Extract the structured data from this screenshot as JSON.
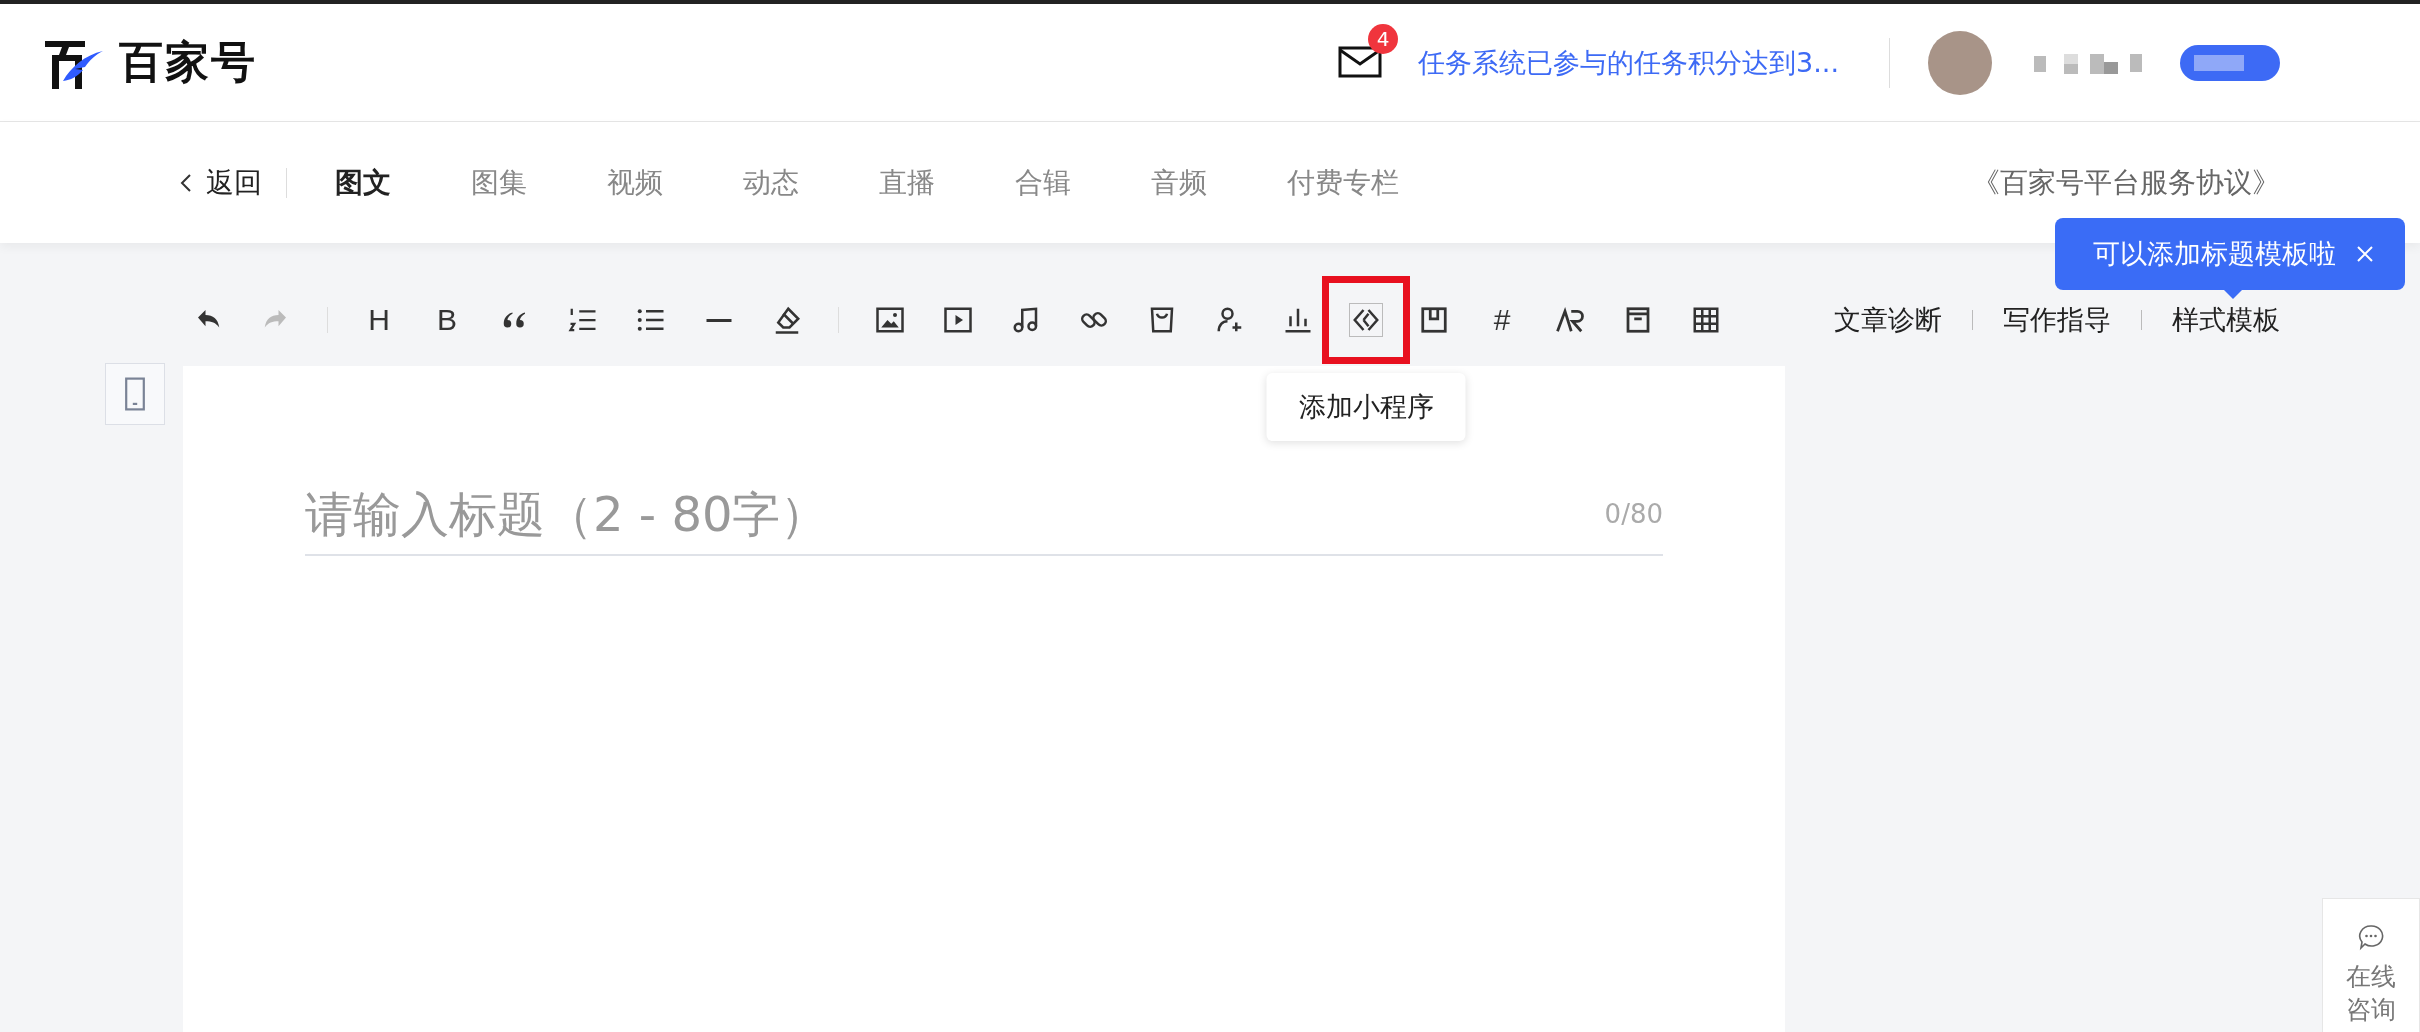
{
  "header": {
    "logo_text": "百家号",
    "notification": {
      "count": "4",
      "text": "任务系统已参与的任务积分达到3..."
    }
  },
  "nav": {
    "back": "返回",
    "tabs": [
      {
        "label": "图文",
        "selected": true
      },
      {
        "label": "图集",
        "selected": false
      },
      {
        "label": "视频",
        "selected": false
      },
      {
        "label": "动态",
        "selected": false
      },
      {
        "label": "直播",
        "selected": false
      },
      {
        "label": "合辑",
        "selected": false
      },
      {
        "label": "音频",
        "selected": false
      },
      {
        "label": "付费专栏",
        "selected": false
      }
    ],
    "agreement": "《百家号平台服务协议》"
  },
  "toolbar": {
    "items": [
      {
        "kind": "undo",
        "disabled": false,
        "hovered": false
      },
      {
        "kind": "redo",
        "disabled": true,
        "hovered": false
      },
      {
        "kind": "separator"
      },
      {
        "kind": "text",
        "label": "H",
        "disabled": false,
        "hovered": false
      },
      {
        "kind": "text",
        "label": "B",
        "disabled": false,
        "hovered": false
      },
      {
        "kind": "quote",
        "disabled": false,
        "hovered": false
      },
      {
        "kind": "ordered-list",
        "disabled": false,
        "hovered": false
      },
      {
        "kind": "bullet-list",
        "disabled": false,
        "hovered": false
      },
      {
        "kind": "rule",
        "disabled": false,
        "hovered": false
      },
      {
        "kind": "eraser",
        "disabled": false,
        "hovered": false
      },
      {
        "kind": "separator"
      },
      {
        "kind": "image",
        "disabled": false,
        "hovered": false
      },
      {
        "kind": "video",
        "disabled": false,
        "hovered": false
      },
      {
        "kind": "music",
        "disabled": false,
        "hovered": false
      },
      {
        "kind": "link",
        "disabled": false,
        "hovered": false
      },
      {
        "kind": "bag",
        "disabled": false,
        "hovered": false
      },
      {
        "kind": "person-add",
        "disabled": false,
        "hovered": false
      },
      {
        "kind": "chart",
        "disabled": false,
        "hovered": false
      },
      {
        "kind": "mini-program",
        "disabled": false,
        "hovered": true,
        "tooltip": "添加小程序"
      },
      {
        "kind": "bookmark",
        "disabled": false,
        "hovered": false
      },
      {
        "kind": "text",
        "label": "#",
        "disabled": false,
        "hovered": false
      },
      {
        "kind": "ar",
        "disabled": false,
        "hovered": false
      },
      {
        "kind": "box",
        "disabled": false,
        "hovered": false
      },
      {
        "kind": "table",
        "disabled": false,
        "hovered": false
      }
    ],
    "links": [
      "文章诊断",
      "写作指导",
      "样式模板"
    ]
  },
  "template_tip": {
    "text": "可以添加标题模板啦"
  },
  "editor": {
    "title": {
      "placeholder": "请输入标题（2 - 80字）",
      "counter": "0/80"
    }
  },
  "consult": {
    "label": "在线咨询"
  }
}
